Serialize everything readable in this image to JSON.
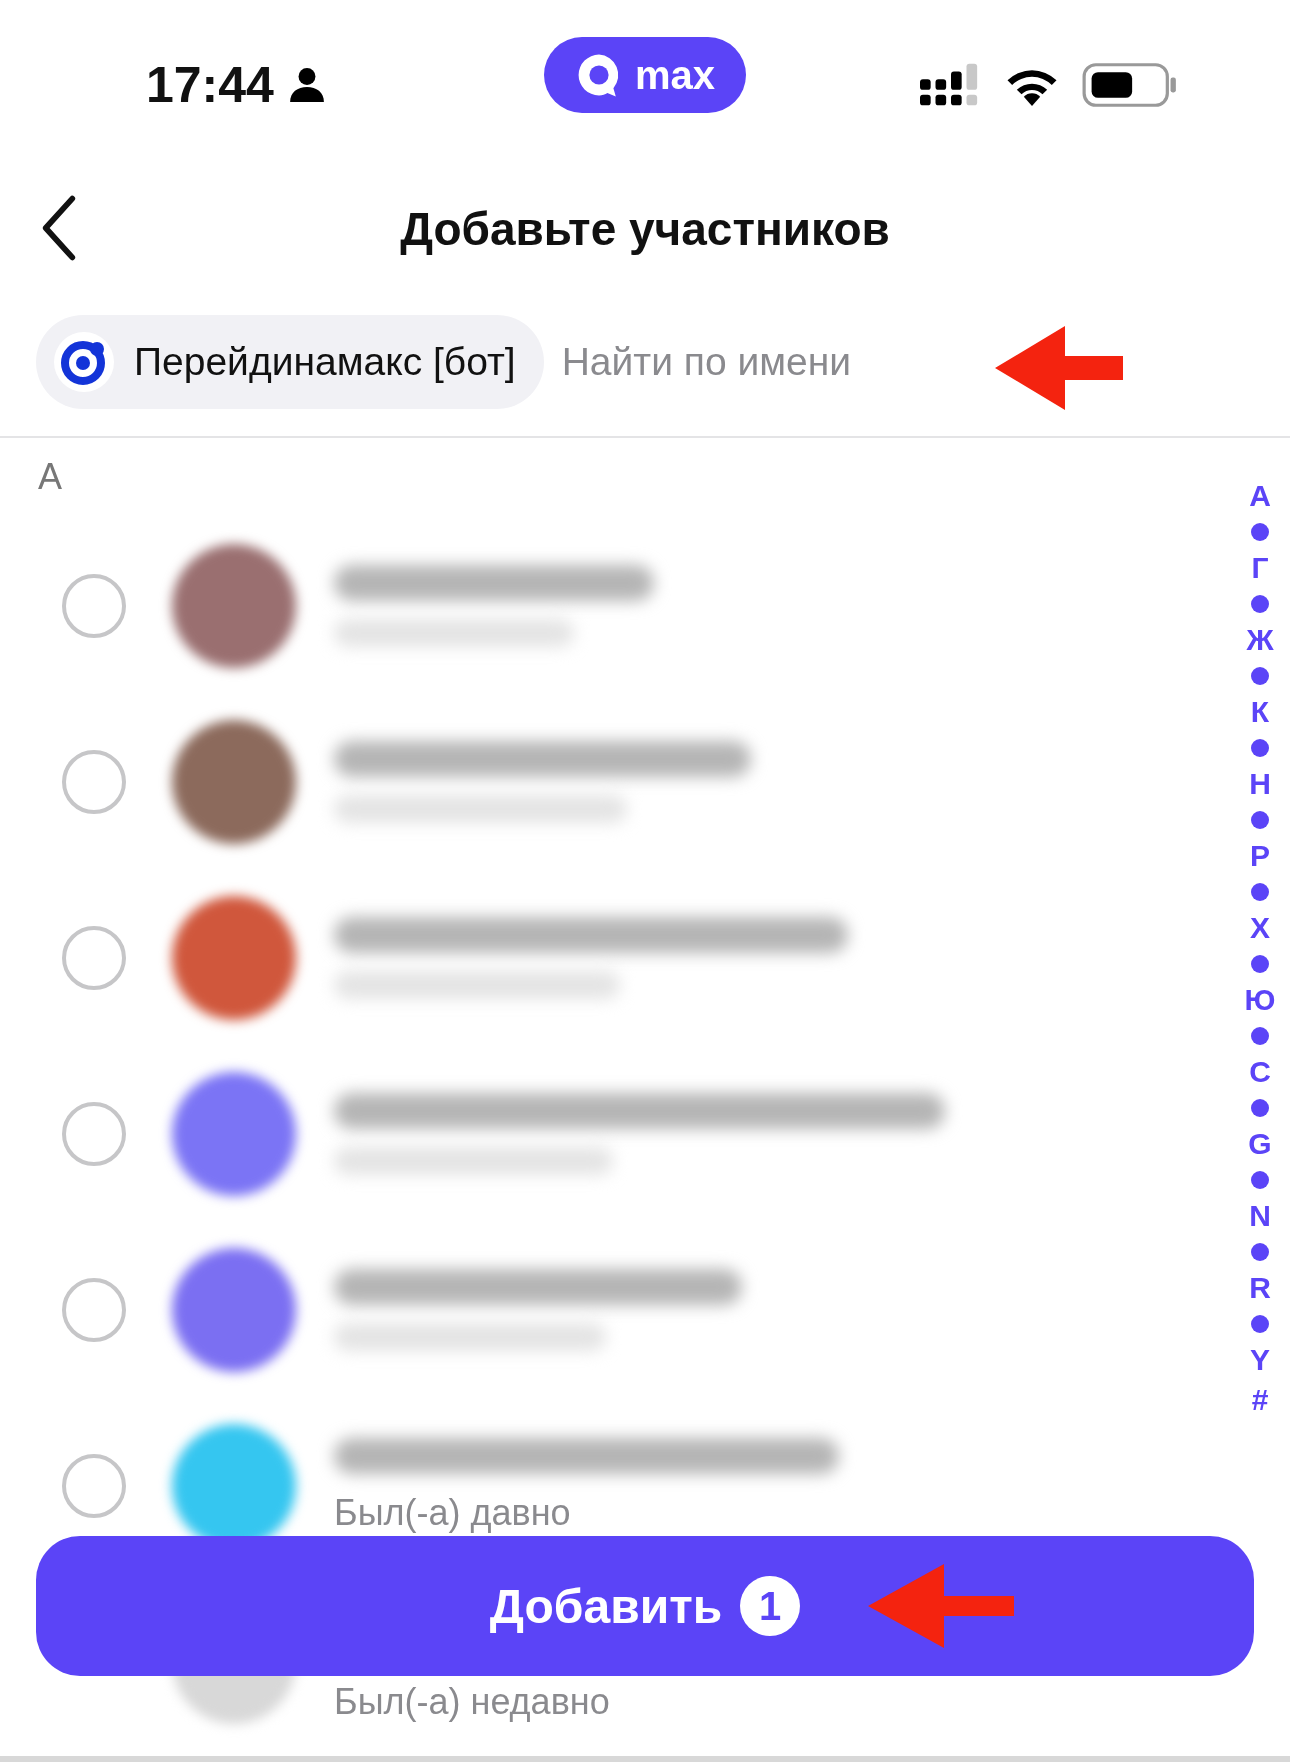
{
  "status_bar": {
    "time": "17:44",
    "app_badge": "max"
  },
  "header": {
    "title": "Добавьте участников"
  },
  "selected_chips": [
    {
      "label": "Перейдинамакс [бот]"
    }
  ],
  "search": {
    "placeholder": "Найти по имени"
  },
  "section": {
    "letter": "А"
  },
  "contacts": [
    {
      "selected": false,
      "color": "#9a6f70"
    },
    {
      "selected": false,
      "color": "#8c6a5c"
    },
    {
      "selected": false,
      "color": "#d0573c"
    },
    {
      "selected": false,
      "color": "#7b74f5"
    },
    {
      "selected": false,
      "color": "#7b6ff2"
    },
    {
      "selected": false,
      "color": "#35c6f0",
      "status": "Был(-а) давно"
    },
    {
      "color": "#d8d8d8",
      "status": "Был(-а) недавно"
    }
  ],
  "alphabet_index": [
    "А",
    "Г",
    "Ж",
    "К",
    "Н",
    "Р",
    "Х",
    "Ю",
    "С",
    "G",
    "N",
    "R",
    "Y",
    "#"
  ],
  "add_button": {
    "label": "Добавить",
    "count": "1"
  }
}
